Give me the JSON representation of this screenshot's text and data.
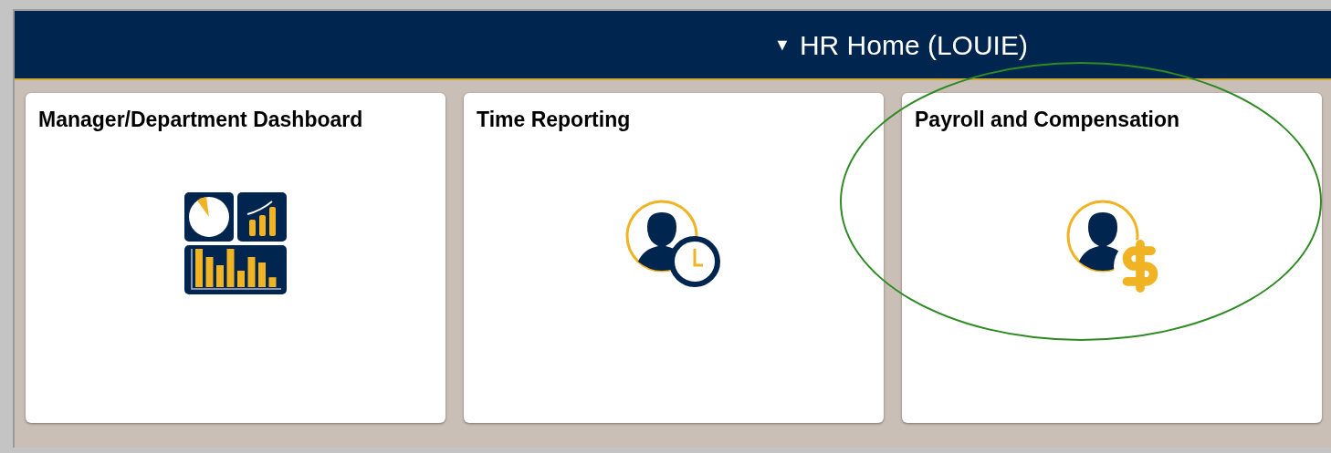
{
  "header": {
    "caret": "▼",
    "title": "HR Home (LOUIE)"
  },
  "tiles": [
    {
      "title": "Manager/Department Dashboard",
      "kind": "dashboard",
      "circled": false
    },
    {
      "title": "Time Reporting",
      "kind": "clock",
      "circled": false
    },
    {
      "title": "Payroll and Compensation",
      "kind": "dollar",
      "circled": true
    }
  ]
}
